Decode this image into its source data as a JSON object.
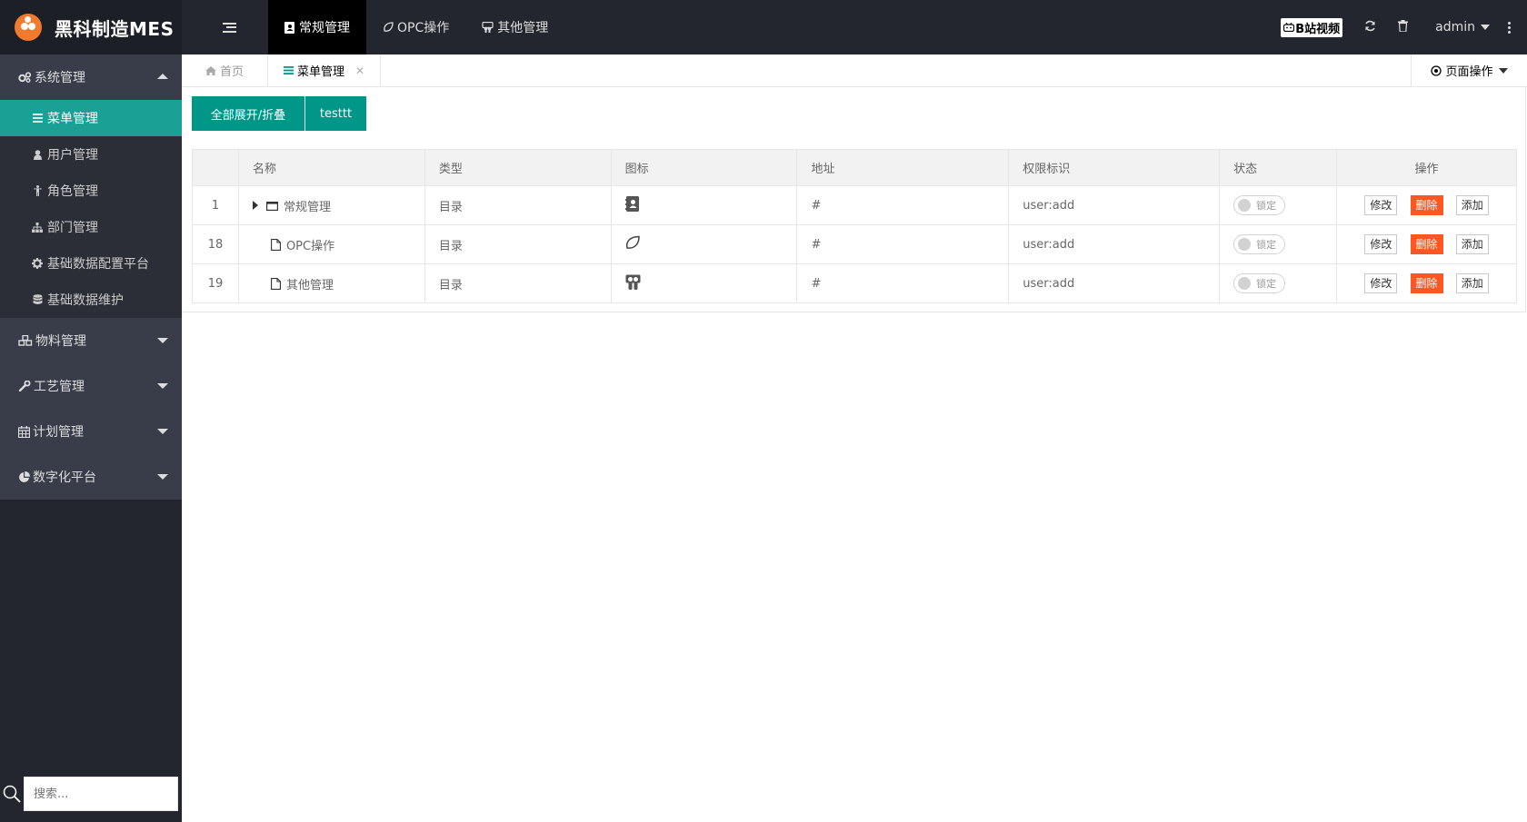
{
  "app": {
    "title": "黑科制造MES"
  },
  "topnav": [
    {
      "label": "常规管理",
      "icon": "address-book-icon",
      "active": true
    },
    {
      "label": "OPC操作",
      "icon": "leaf-icon",
      "active": false
    },
    {
      "label": "其他管理",
      "icon": "slideshare-icon",
      "active": false
    }
  ],
  "topright": {
    "bilibili": "B站视频",
    "user": "admin"
  },
  "sidebar": {
    "groups": [
      {
        "label": "系统管理",
        "open": true,
        "items": [
          {
            "label": "菜单管理",
            "active": true
          },
          {
            "label": "用户管理"
          },
          {
            "label": "角色管理"
          },
          {
            "label": "部门管理"
          },
          {
            "label": "基础数据配置平台"
          },
          {
            "label": "基础数据维护"
          }
        ]
      },
      {
        "label": "物料管理"
      },
      {
        "label": "工艺管理"
      },
      {
        "label": "计划管理"
      },
      {
        "label": "数字化平台"
      }
    ],
    "search_placeholder": "搜索..."
  },
  "tabs": {
    "home": "首页",
    "current": "菜单管理",
    "page_ops": "页面操作"
  },
  "toolbar": {
    "expand": "全部展开/折叠",
    "testtt": "testtt"
  },
  "table": {
    "headers": [
      "",
      "名称",
      "类型",
      "图标",
      "地址",
      "权限标识",
      "状态",
      "操作"
    ],
    "rows": [
      {
        "id": "1",
        "name": "常规管理",
        "type": "目录",
        "icon": "address-book-icon",
        "href": "#",
        "perm": "user:add",
        "status": "锁定"
      },
      {
        "id": "18",
        "name": "OPC操作",
        "type": "目录",
        "icon": "leaf-icon",
        "href": "#",
        "perm": "user:add",
        "status": "锁定"
      },
      {
        "id": "19",
        "name": "其他管理",
        "type": "目录",
        "icon": "slideshare-icon",
        "href": "#",
        "perm": "user:add",
        "status": "锁定"
      }
    ],
    "actions": {
      "edit": "修改",
      "delete": "删除",
      "add": "添加"
    }
  },
  "colors": {
    "accent": "#009688",
    "sidebar_active": "#1aa094",
    "danger": "#ff5722",
    "header": "#23262e"
  }
}
